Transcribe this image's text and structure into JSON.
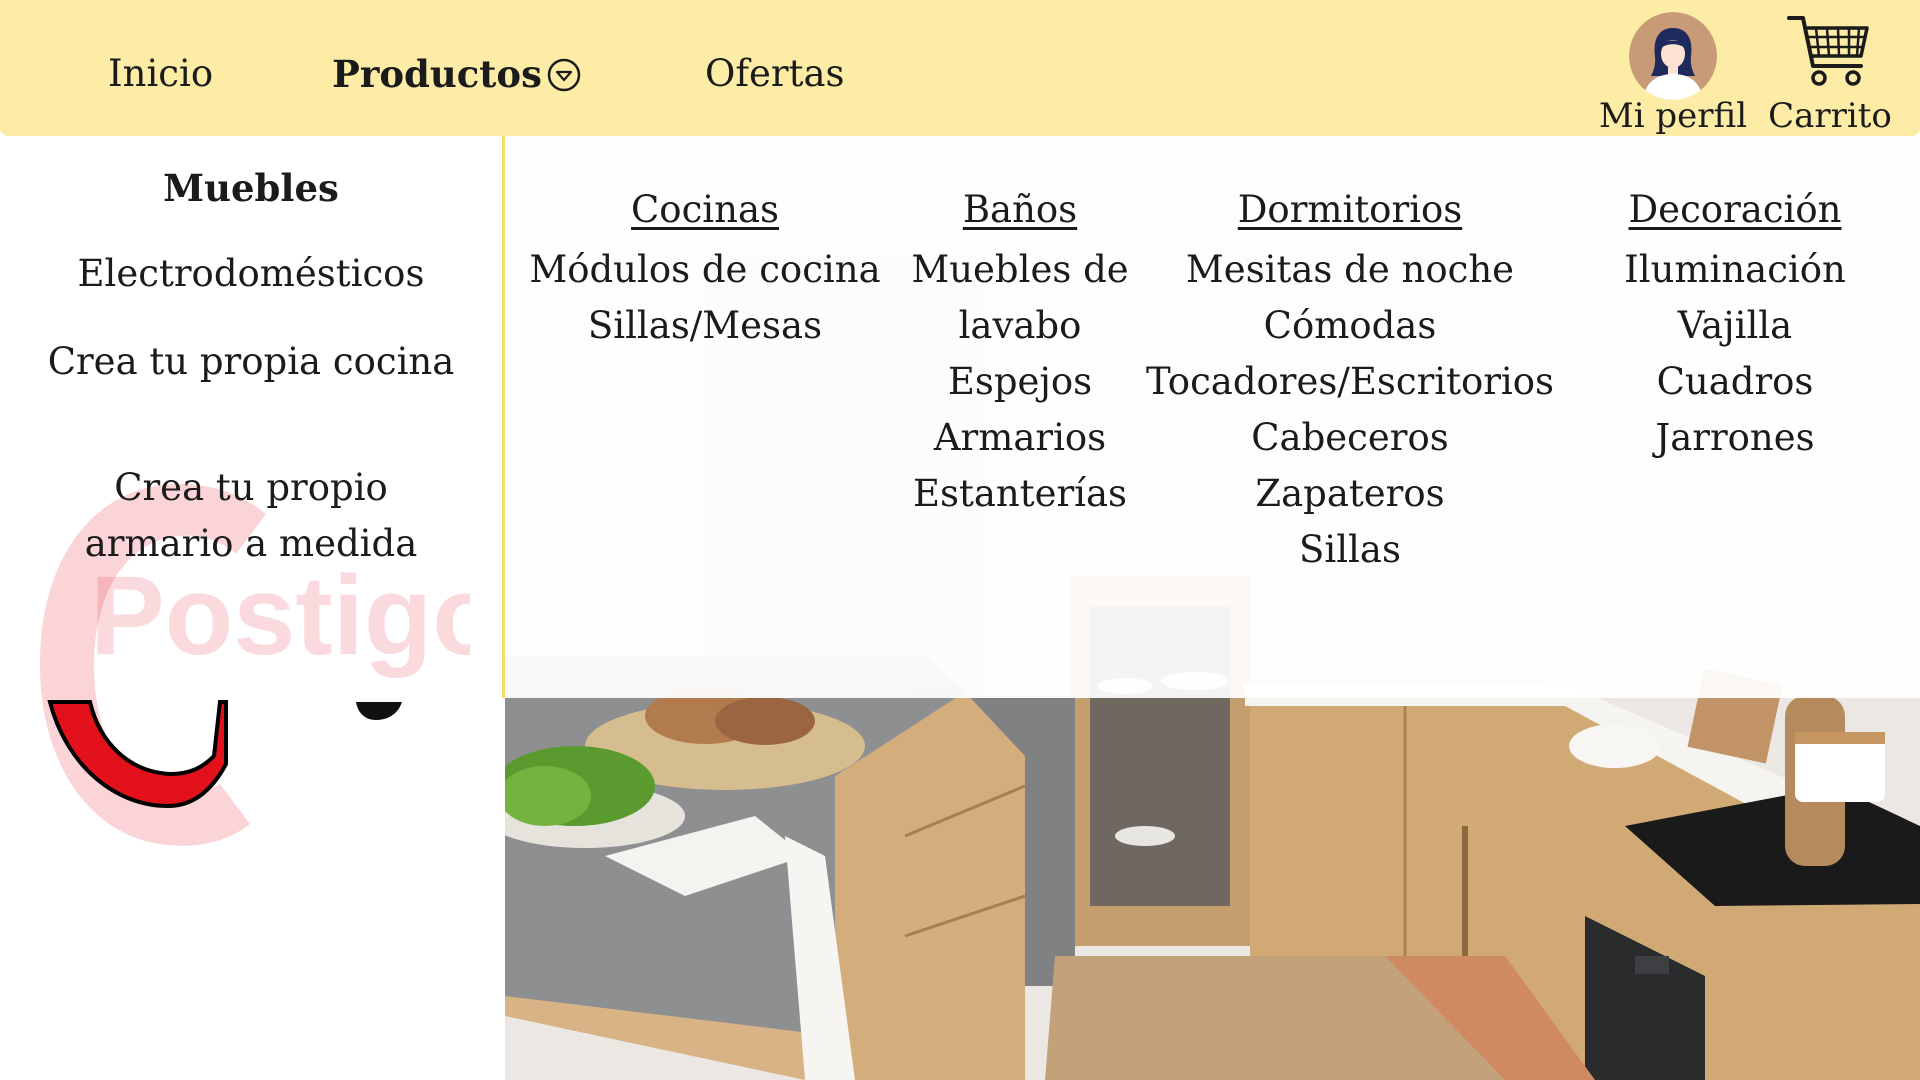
{
  "nav": {
    "inicio": "Inicio",
    "productos": "Productos",
    "ofertas": "Ofertas"
  },
  "profile": {
    "label": "Mi perfil"
  },
  "cart": {
    "label": "Carrito"
  },
  "sidebar": {
    "items": [
      {
        "label": "Muebles",
        "active": true
      },
      {
        "label": "Electrodomésticos"
      },
      {
        "label": "Crea tu propia cocina"
      },
      {
        "label": "Crea tu propio armario a medida"
      }
    ],
    "logo_text": "Postigo"
  },
  "mega_menu": {
    "columns": [
      {
        "heading": "Cocinas",
        "items": [
          "Módulos de cocina",
          "Sillas/Mesas"
        ]
      },
      {
        "heading": "Baños",
        "items": [
          "Muebles de lavabo",
          "Espejos",
          "Armarios",
          "Estanterías"
        ]
      },
      {
        "heading": "Dormitorios",
        "items": [
          "Mesitas de noche",
          "Cómodas",
          "Tocadores/Escritorios",
          "Cabeceros",
          "Zapateros",
          "Sillas"
        ]
      },
      {
        "heading": "Decoración",
        "items": [
          "Iluminación",
          "Vajilla",
          "Cuadros",
          "Jarrones"
        ]
      }
    ]
  },
  "icons": {
    "productos_chevron": "chevron-down-circle-icon",
    "avatar": "user-avatar-icon",
    "cart": "shopping-cart-icon"
  },
  "colors": {
    "topbar": "#fdeca6",
    "accent_divider": "#f6dc6b",
    "logo_red": "#e3111b"
  }
}
